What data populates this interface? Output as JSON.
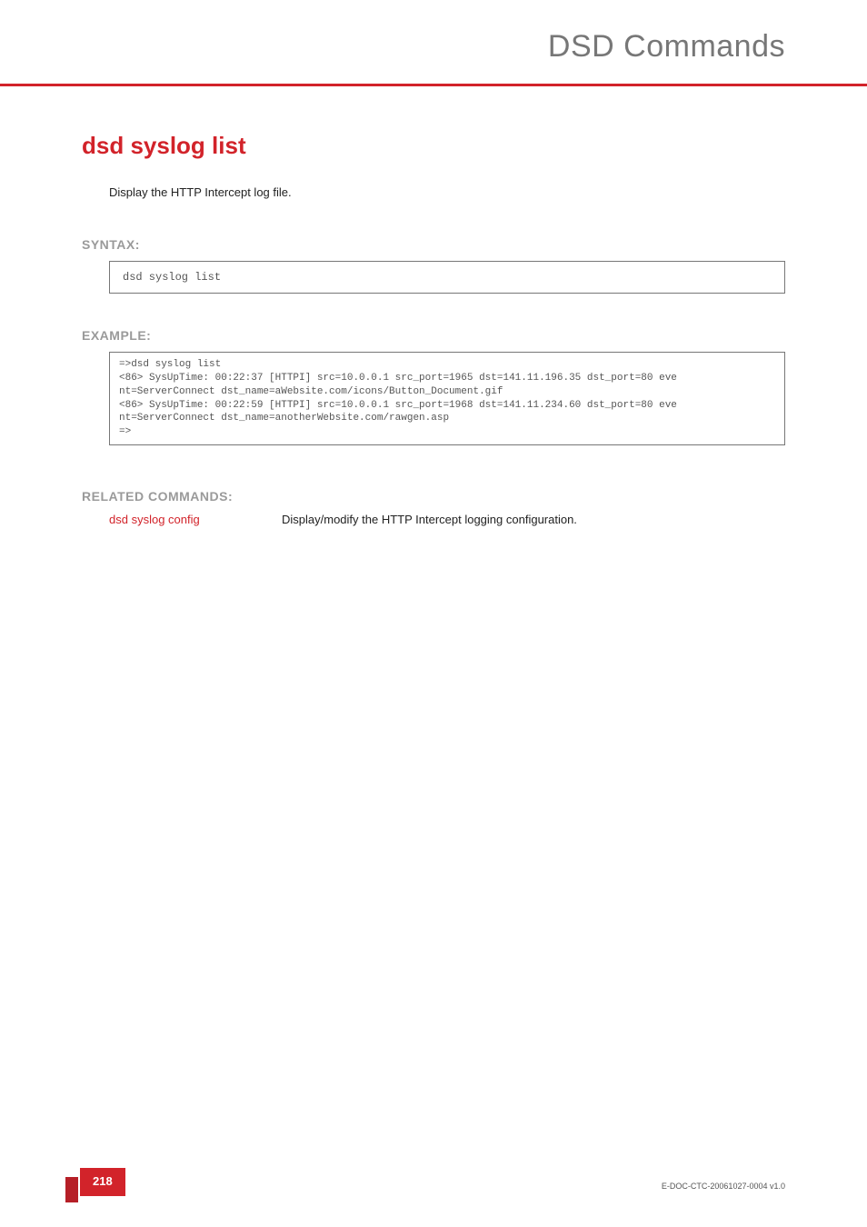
{
  "header": {
    "title": "DSD Commands"
  },
  "page": {
    "h1": "dsd syslog list",
    "intro": "Display the HTTP Intercept log file."
  },
  "sections": {
    "syntax_label": "SYNTAX:",
    "syntax_code": "dsd syslog list",
    "example_label": "EXAMPLE:",
    "example_code": "=>dsd syslog list\n<86> SysUpTime: 00:22:37 [HTTPI] src=10.0.0.1 src_port=1965 dst=141.11.196.35 dst_port=80 eve\nnt=ServerConnect dst_name=aWebsite.com/icons/Button_Document.gif\n<86> SysUpTime: 00:22:59 [HTTPI] src=10.0.0.1 src_port=1968 dst=141.11.234.60 dst_port=80 eve\nnt=ServerConnect dst_name=anotherWebsite.com/rawgen.asp\n=>",
    "related_label": "RELATED COMMANDS:",
    "related": {
      "cmd": "dsd syslog config",
      "desc": "Display/modify the HTTP Intercept logging configuration."
    }
  },
  "footer": {
    "page_number": "218",
    "doc_id": "E-DOC-CTC-20061027-0004 v1.0"
  }
}
